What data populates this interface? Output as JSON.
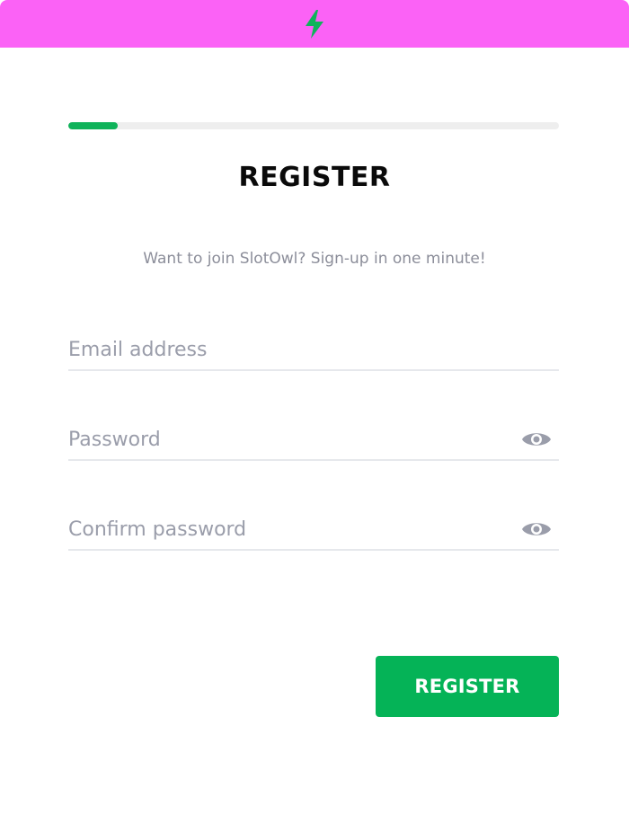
{
  "header": {
    "icon": "lightning-bolt-icon",
    "background_color": "#fb62f6",
    "icon_color": "#0fb35a"
  },
  "progress": {
    "value": 0.1,
    "fill_color": "#0fb35a",
    "track_color": "#eeeeee"
  },
  "form": {
    "title": "REGISTER",
    "subtitle": "Want to join SlotOwl? Sign-up in one minute!",
    "fields": [
      {
        "placeholder": "Email address",
        "value": "",
        "type": "email"
      },
      {
        "placeholder": "Password",
        "value": "",
        "type": "password",
        "icon": "eye-icon"
      },
      {
        "placeholder": "Confirm password",
        "value": "",
        "type": "password",
        "icon": "eye-icon"
      }
    ],
    "submit_label": "REGISTER",
    "submit_color": "#05b357"
  }
}
